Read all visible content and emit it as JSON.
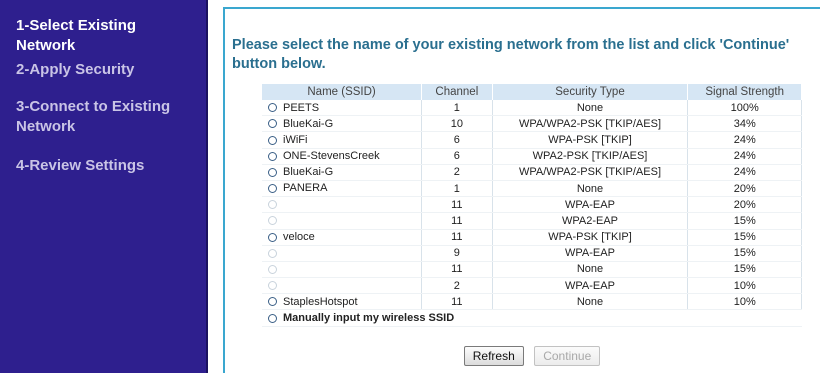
{
  "sidebar": {
    "steps": [
      {
        "label": "1-Select Existing Network"
      },
      {
        "label": "2-Apply Security"
      },
      {
        "label": "3-Connect to Existing Network"
      },
      {
        "label": "4-Review Settings"
      }
    ]
  },
  "main": {
    "prompt": "Please select the name of your existing network from the list and click 'Continue' button below.",
    "table": {
      "headers": [
        "Name (SSID)",
        "Channel",
        "Security Type",
        "Signal Strength"
      ],
      "rows": [
        {
          "ssid": "PEETS",
          "channel": "1",
          "security": "None",
          "signal": "100%"
        },
        {
          "ssid": "BlueKai-G",
          "channel": "10",
          "security": "WPA/WPA2-PSK [TKIP/AES]",
          "signal": "34%"
        },
        {
          "ssid": "iWiFi",
          "channel": "6",
          "security": "WPA-PSK [TKIP]",
          "signal": "24%"
        },
        {
          "ssid": "ONE-StevensCreek",
          "channel": "6",
          "security": "WPA2-PSK [TKIP/AES]",
          "signal": "24%"
        },
        {
          "ssid": "BlueKai-G",
          "channel": "2",
          "security": "WPA/WPA2-PSK [TKIP/AES]",
          "signal": "24%"
        },
        {
          "ssid": "PANERA",
          "channel": "1",
          "security": "None",
          "signal": "20%"
        },
        {
          "ssid": "",
          "channel": "11",
          "security": "WPA-EAP",
          "signal": "20%"
        },
        {
          "ssid": "",
          "channel": "11",
          "security": "WPA2-EAP",
          "signal": "15%"
        },
        {
          "ssid": "veloce",
          "channel": "11",
          "security": "WPA-PSK [TKIP]",
          "signal": "15%"
        },
        {
          "ssid": "",
          "channel": "9",
          "security": "WPA-EAP",
          "signal": "15%"
        },
        {
          "ssid": "",
          "channel": "11",
          "security": "None",
          "signal": "15%"
        },
        {
          "ssid": "",
          "channel": "2",
          "security": "WPA-EAP",
          "signal": "10%"
        },
        {
          "ssid": "StaplesHotspot",
          "channel": "11",
          "security": "None",
          "signal": "10%"
        }
      ],
      "manual_label": "Manually input my wireless SSID"
    },
    "buttons": {
      "refresh": "Refresh",
      "continue": "Continue"
    }
  }
}
